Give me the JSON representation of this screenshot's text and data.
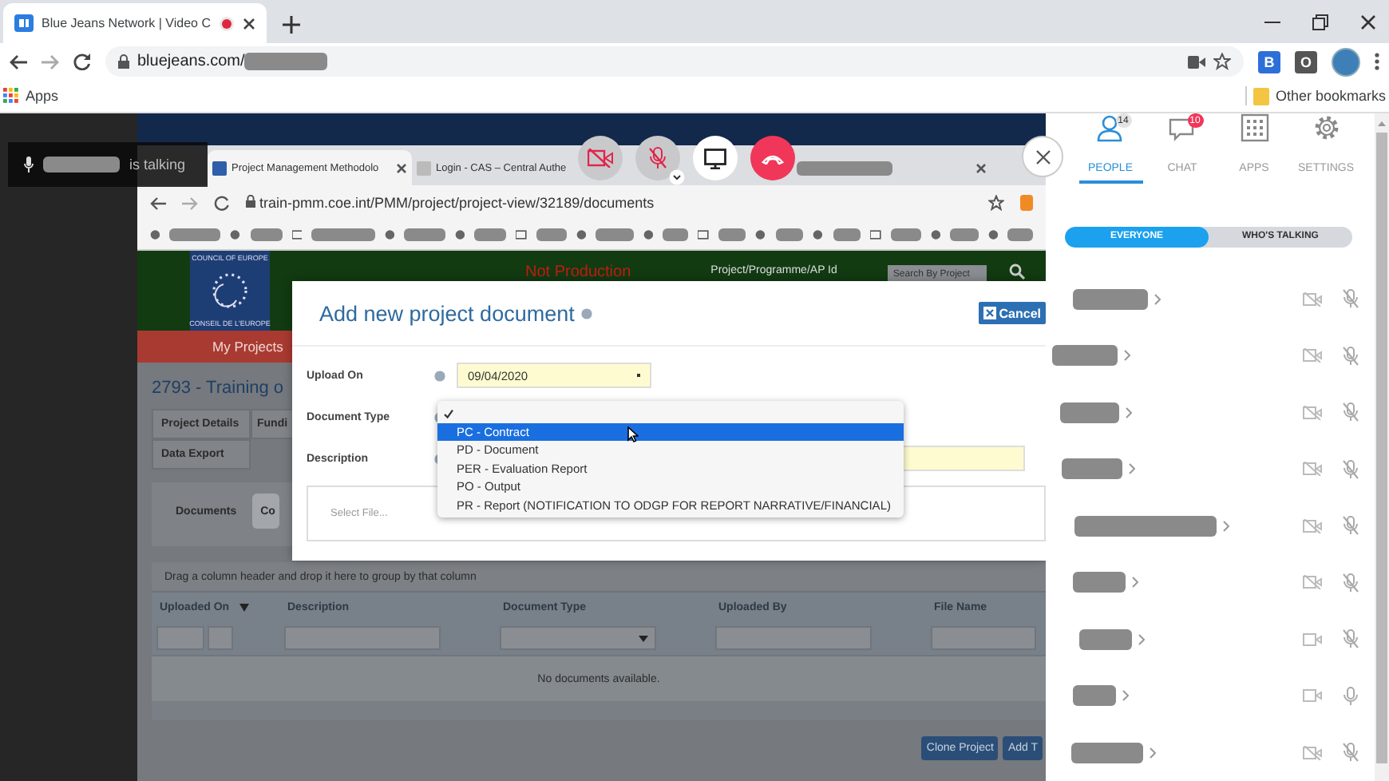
{
  "browser": {
    "tabs": [
      {
        "title": "Blue Jeans Network | Video C",
        "recording": true,
        "selected": true
      }
    ],
    "url": "bluejeans.com/",
    "extensions": [
      "B",
      "O"
    ],
    "bookmarks": {
      "apps": "Apps",
      "other": "Other bookmarks"
    }
  },
  "talking_indicator": {
    "text": "is talking"
  },
  "call_controls": [
    {
      "kind": "camera",
      "on": false
    },
    {
      "kind": "mic",
      "on": false
    },
    {
      "kind": "screen",
      "on": true
    },
    {
      "kind": "hangup"
    }
  ],
  "shared_screen": {
    "tabs": [
      {
        "kind": "page",
        "title": "Project Management Methodolo",
        "selected": true
      },
      {
        "kind": "page",
        "title": "Login - CAS – Central Authe",
        "selected": false
      },
      {
        "kind": "redacted",
        "selected": false
      }
    ],
    "url": "train-pmm.coe.int/PMM/project/project-view/32189/documents",
    "site": {
      "org": "COUNCIL OF EUROPE",
      "org_alt": "CONSEIL DE L'EUROPE",
      "env": "Not Production",
      "search_label": "Project/Programme/AP Id",
      "search_placeholder": "Search By Project",
      "nav": [
        "My Projects"
      ]
    },
    "project_title": "2793 - Training o",
    "project_tabs": [
      "Project Details",
      "Fundi",
      "Data Export"
    ],
    "doc_tabs": [
      {
        "label": "Documents",
        "selected": true
      },
      {
        "label": "Co",
        "selected": false
      }
    ],
    "grid": {
      "group_hint": "Drag a column header and drop it here to group by that column",
      "columns": [
        {
          "label": "Uploaded On",
          "sorted": true,
          "kind": "date"
        },
        {
          "label": "Description",
          "sorted": false,
          "kind": "text"
        },
        {
          "label": "Document Type",
          "sorted": false,
          "kind": "select"
        },
        {
          "label": "Uploaded By",
          "sorted": false,
          "kind": "text"
        },
        {
          "label": "File Name",
          "sorted": false,
          "kind": "text"
        }
      ],
      "empty": "No documents available."
    },
    "buttons": [
      "Clone Project",
      "Add T"
    ],
    "dialog": {
      "title": "Add new project document",
      "cancel": "Cancel",
      "fields": [
        {
          "label": "Upload On",
          "kind": "date",
          "value": "09/04/2020"
        },
        {
          "label": "Document Type",
          "kind": "select"
        },
        {
          "label": "Description",
          "kind": "text"
        }
      ],
      "file_placeholder": "Select File...",
      "dropdown": {
        "options": [
          {
            "kind": "blank",
            "checked": true,
            "hovered": false
          },
          {
            "kind": "item",
            "label": "PC - Contract",
            "checked": false,
            "hovered": true
          },
          {
            "kind": "item",
            "label": "PD - Document",
            "checked": false,
            "hovered": false
          },
          {
            "kind": "item",
            "label": "PER - Evaluation Report",
            "checked": false,
            "hovered": false
          },
          {
            "kind": "item",
            "label": "PO - Output",
            "checked": false,
            "hovered": false
          },
          {
            "kind": "item",
            "label": "PR - Report (NOTIFICATION TO ODGP FOR REPORT NARRATIVE/FINANCIAL)",
            "checked": false,
            "hovered": false
          }
        ]
      }
    }
  },
  "panel": {
    "tabs": [
      {
        "label": "PEOPLE",
        "kind": "people",
        "badge": {
          "text": "14",
          "color": "#e3e3e3"
        },
        "selected": true
      },
      {
        "label": "CHAT",
        "kind": "chat",
        "badge": {
          "text": "10",
          "color": "#f0375a"
        },
        "selected": false
      },
      {
        "label": "APPS",
        "kind": "apps",
        "selected": false
      },
      {
        "label": "SETTINGS",
        "kind": "settings",
        "selected": false
      }
    ],
    "filter": [
      {
        "label": "EVERYONE",
        "selected": true
      },
      {
        "label": "WHO'S TALKING",
        "selected": false
      }
    ],
    "participants": [
      {
        "camera_on": false,
        "muted": true
      },
      {
        "camera_on": false,
        "muted": true
      },
      {
        "camera_on": false,
        "muted": true
      },
      {
        "camera_on": false,
        "muted": true
      },
      {
        "camera_on": false,
        "muted": true
      },
      {
        "camera_on": false,
        "muted": true
      },
      {
        "camera_on": true,
        "muted": true
      },
      {
        "camera_on": true,
        "muted": false
      },
      {
        "camera_on": false,
        "muted": true
      }
    ]
  }
}
